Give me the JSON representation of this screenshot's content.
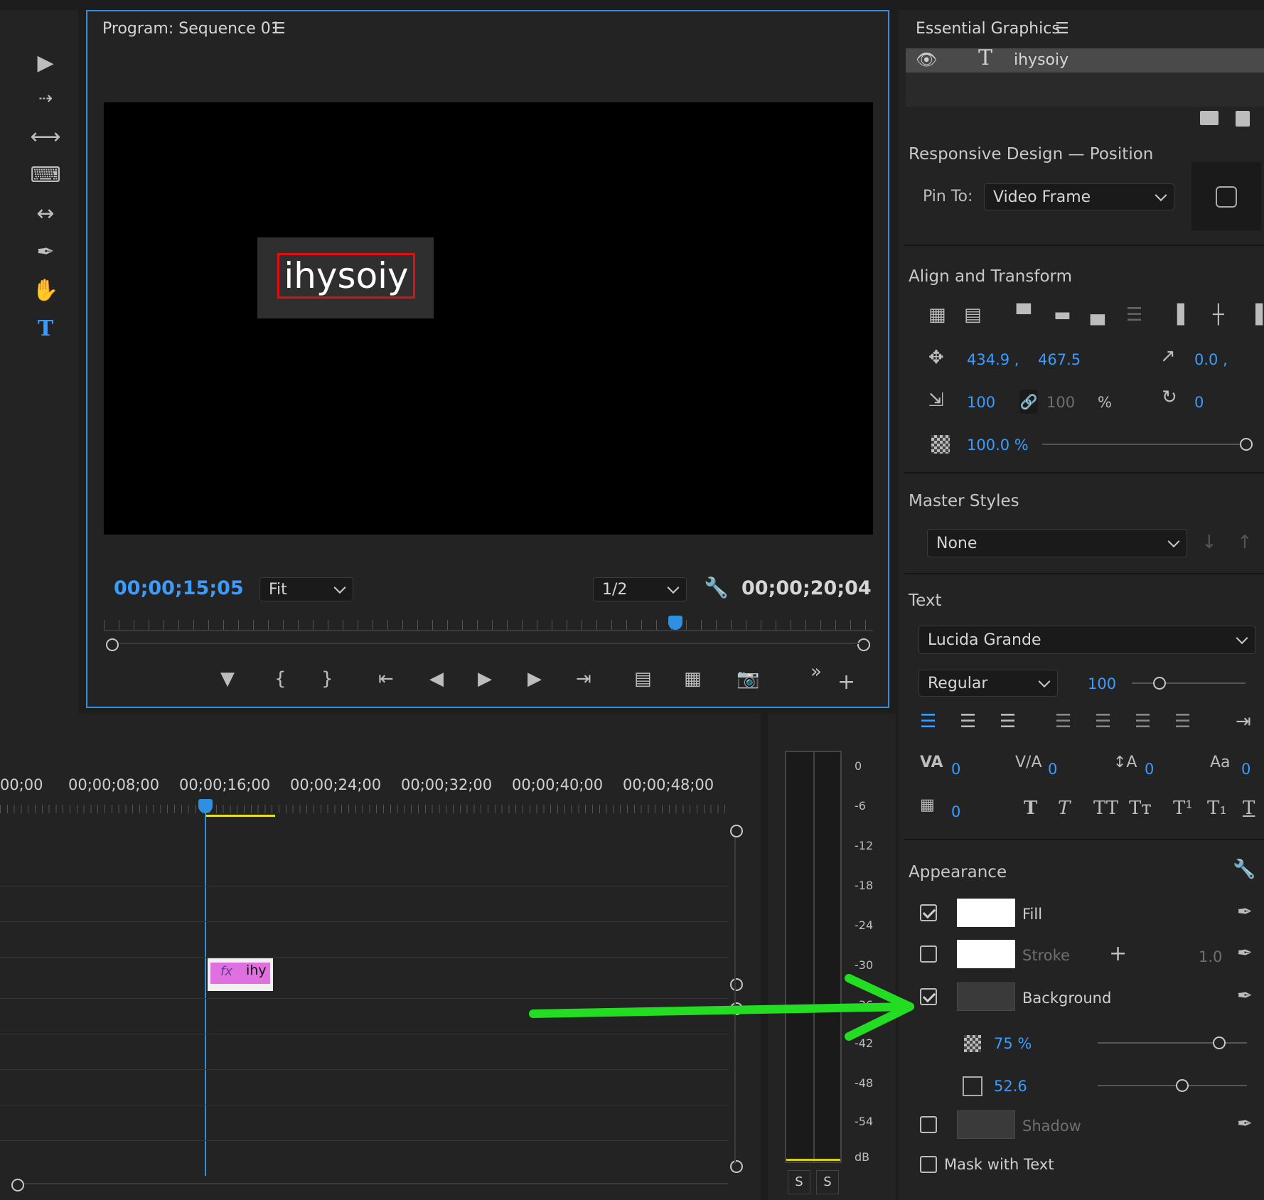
{
  "colors": {
    "accent": "#3b9cff",
    "arrow": "#22dd22",
    "clip": "#e070e0",
    "panel": "#232323"
  },
  "program": {
    "title": "Program: Sequence 01",
    "timecode_current": "00;00;15;05",
    "timecode_duration": "00;00;20;04",
    "fit": "Fit",
    "resolution": "1/2",
    "overlay_text": "ihysoiy"
  },
  "timeline": {
    "ruler": [
      "00;00",
      "00;00;08;00",
      "00;00;16;00",
      "00;00;24;00",
      "00;00;32;00",
      "00;00;40;00",
      "00;00;48;00"
    ],
    "clip_label": "ihy",
    "clip_fx": "fx"
  },
  "meter": {
    "db_labels": [
      "0",
      "-6",
      "-12",
      "-18",
      "-24",
      "-30",
      "-36",
      "-42",
      "-48",
      "-54",
      "dB"
    ],
    "solo": [
      "S",
      "S"
    ]
  },
  "essential": {
    "title": "Essential Graphics",
    "layer": "ihysoiy",
    "responsive_title": "Responsive Design — Position",
    "pin_label": "Pin To:",
    "pin_value": "Video Frame",
    "align_title": "Align and Transform",
    "pos_x": "434.9 ,",
    "pos_y": "467.5",
    "anchor": "0.0 ,",
    "scale": "100",
    "scale_h": "100",
    "pct": "%",
    "rotation": "0",
    "opacity": "100.0 %",
    "master_title": "Master Styles",
    "master_value": "None",
    "text_title": "Text",
    "font": "Lucida Grande",
    "style": "Regular",
    "size": "100",
    "kern": "0",
    "track": "0",
    "lead": "0",
    "baseline": "0",
    "tsume": "0",
    "appearance_title": "Appearance",
    "fill": "Fill",
    "stroke": "Stroke",
    "stroke_width": "1.0",
    "background": "Background",
    "bg_opacity": "75 %",
    "bg_size": "52.6",
    "shadow": "Shadow",
    "mask": "Mask with Text"
  }
}
